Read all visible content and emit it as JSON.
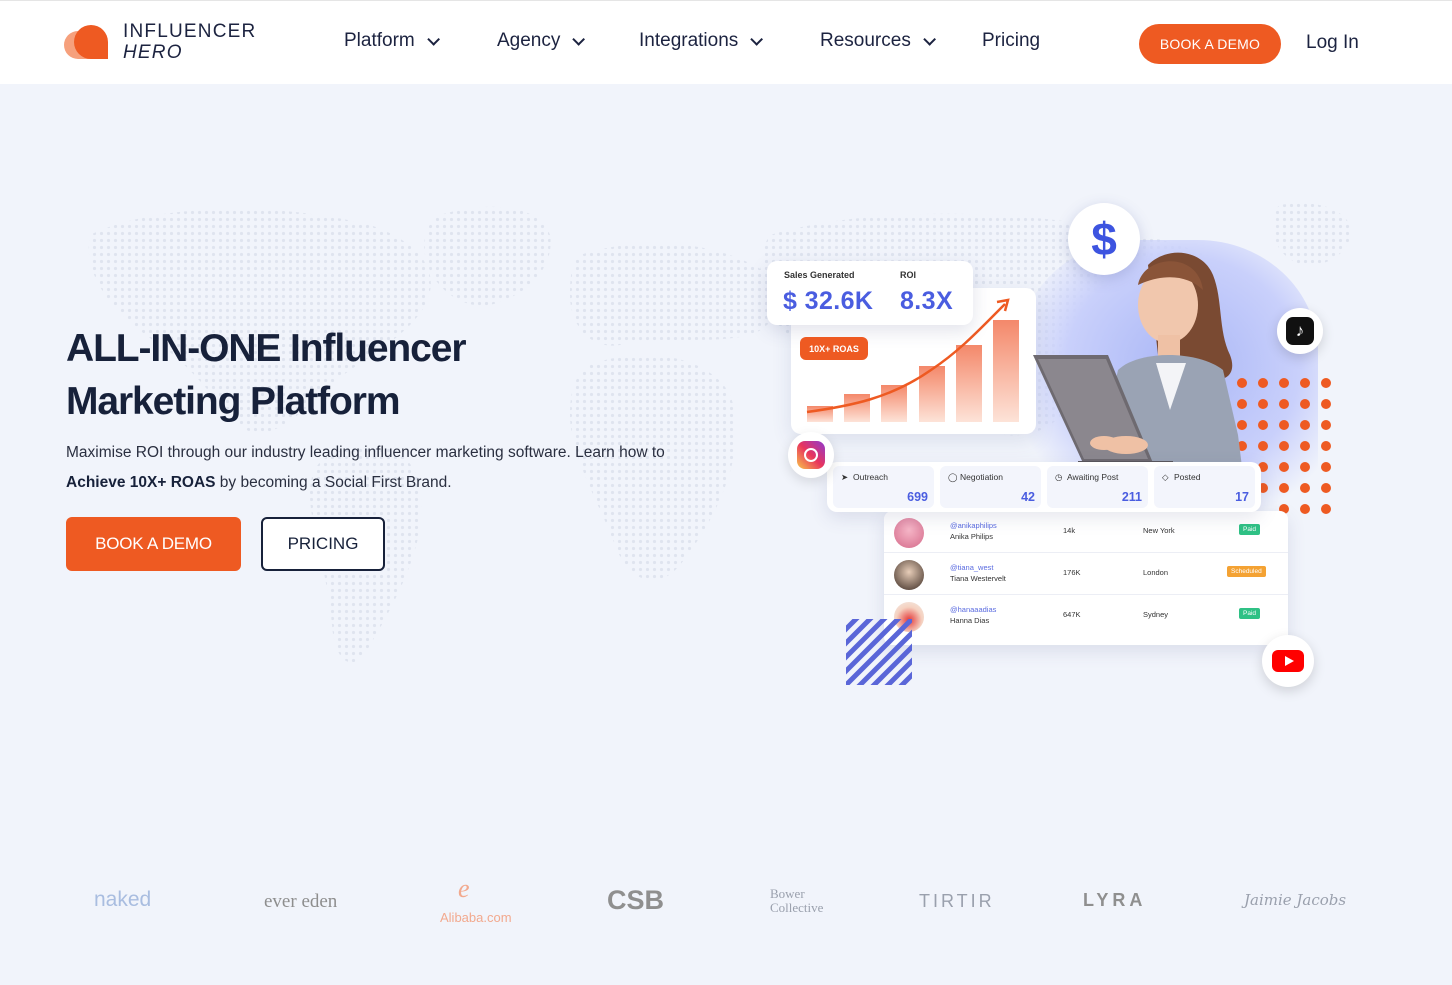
{
  "nav": {
    "logo_line1": "INFLUENCER",
    "logo_line2": "HERO",
    "menu": [
      {
        "label": "Platform",
        "dropdown": true
      },
      {
        "label": "Agency",
        "dropdown": true
      },
      {
        "label": "Integrations",
        "dropdown": true
      },
      {
        "label": "Resources",
        "dropdown": true
      },
      {
        "label": "Pricing",
        "dropdown": false
      }
    ],
    "book_demo": "BOOK A DEMO",
    "login": "Log In"
  },
  "hero": {
    "title_line1": "ALL-IN-ONE Influencer",
    "title_line2": "Marketing Platform",
    "subtitle_part1": "Maximise ROI through our industry leading influencer marketing software. Learn how to ",
    "subtitle_bold": "Achieve 10X+ ROAS",
    "subtitle_part2": " by becoming a Social First Brand.",
    "cta_primary": "BOOK A DEMO",
    "cta_secondary": "PRICING"
  },
  "illustration": {
    "sales_label": "Sales Generated",
    "sales_value": "$ 32.6K",
    "roi_label": "ROI",
    "roi_value": "8.3X",
    "roas_badge": "10X+ ROAS",
    "stats": [
      {
        "label": "Outreach",
        "value": "699"
      },
      {
        "label": "Negotiation",
        "value": "42"
      },
      {
        "label": "Awaiting Post",
        "value": "211"
      },
      {
        "label": "Posted",
        "value": "17"
      }
    ],
    "influencers": [
      {
        "handle": "@anikaphilips",
        "name": "Anika Philips",
        "followers": "14k",
        "city": "New York",
        "status": "Paid"
      },
      {
        "handle": "@tiana_west",
        "name": "Tiana Westervelt",
        "followers": "176K",
        "city": "London",
        "status": "Scheduled"
      },
      {
        "handle": "@hanaaadias",
        "name": "Hanna Dias",
        "followers": "647K",
        "city": "Sydney",
        "status": "Paid"
      }
    ]
  },
  "brands": [
    "naked",
    "ever eden",
    "Alibaba.com",
    "CSB",
    "Bower Collective",
    "TIRTIR",
    "LYRA",
    "Jaimie Jacobs"
  ],
  "colors": {
    "accent": "#ee5a22",
    "navy": "#17213a",
    "blue": "#4a5de0",
    "background": "#f1f4fb",
    "paid": "#2fc185",
    "scheduled": "#f4a233"
  }
}
